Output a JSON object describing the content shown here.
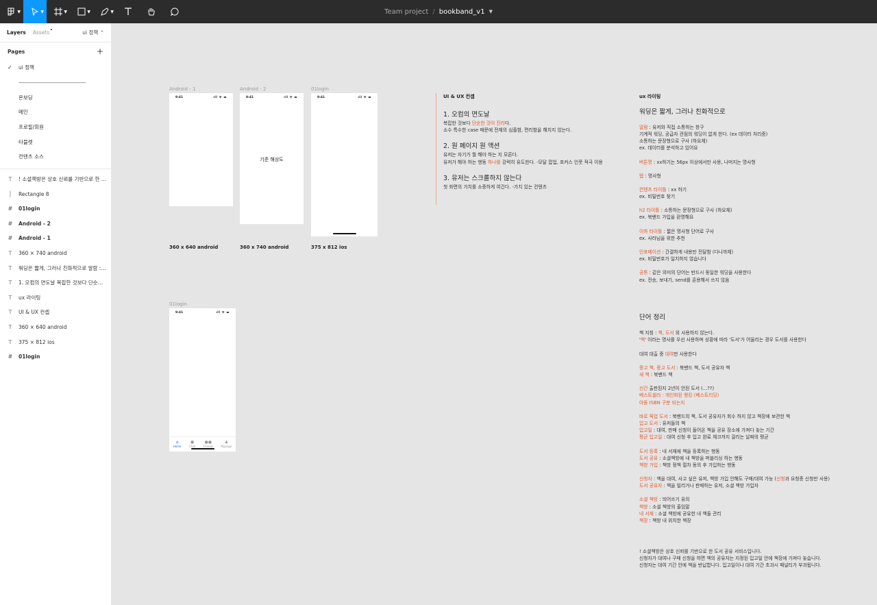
{
  "topbar": {
    "project": "Team project",
    "slash": "/",
    "file": "bookband_v1",
    "tools": [
      "main-menu-icon",
      "move-tool-icon",
      "frame-tool-icon",
      "shape-tool-icon",
      "pen-tool-icon",
      "text-tool-icon",
      "hand-tool-icon",
      "comment-tool-icon"
    ]
  },
  "sidebar": {
    "tab_layers": "Layers",
    "tab_assets": "Assets",
    "page_selector": "ui 정책 ⌃",
    "pages_title": "Pages",
    "pages": [
      {
        "label": "ui 정책",
        "current": true
      },
      {
        "label": "———————————————",
        "current": false
      },
      {
        "label": "온보딩",
        "current": false
      },
      {
        "label": "메인",
        "current": false
      },
      {
        "label": "프로필/회원",
        "current": false
      },
      {
        "label": "타블렛",
        "current": false
      },
      {
        "label": "컨텐츠 소스",
        "current": false
      }
    ],
    "layers": [
      {
        "type": "text",
        "label": "! 소셜책방은 상호 신뢰를 기반으로 한 도..."
      },
      {
        "type": "rect",
        "label": "Rectangle 8"
      },
      {
        "type": "frame",
        "label": "01login"
      },
      {
        "type": "frame",
        "label": "Android - 2"
      },
      {
        "type": "frame",
        "label": "Android - 1"
      },
      {
        "type": "text",
        "label": "360 × 740 android"
      },
      {
        "type": "text",
        "label": "워딩은 짧게, 그러나 친화적으로 알람 : 유..."
      },
      {
        "type": "text",
        "label": "1. 오컴의 면도날 복잡한 것보다 단순한 것..."
      },
      {
        "type": "text",
        "label": "ux 라이팅"
      },
      {
        "type": "text",
        "label": "UI & UX 컨셉"
      },
      {
        "type": "text",
        "label": "360 × 640 android"
      },
      {
        "type": "text",
        "label": "375 × 812 ios"
      },
      {
        "type": "frame",
        "label": "01login"
      }
    ]
  },
  "canvas": {
    "frames": {
      "a1_label": "Android - 1",
      "a2_label": "Android - 2",
      "login_label": "01login",
      "login2_label": "01login",
      "status_time": "9:41",
      "status_icons": "ıll ᯤ ▬",
      "a2_center": "기준 해상도",
      "cap_a1": "360 x 640 android",
      "cap_a2": "360 x 740 android",
      "cap_ios": "375 x 812 ios",
      "tabs": [
        "Home",
        "Chat",
        "Friends",
        "Mypage"
      ]
    },
    "concept": {
      "title": "UI & UX 컨셉",
      "p1_title": "1. 오컴의 면도날",
      "p1_l1_a": "복잡한 것보다 ",
      "p1_l1_o": "단순한 것이 진리",
      "p1_l1_b": "다.",
      "p1_l2": "소수 특수한 case 때문에 전체의 심플함, 편리함을 해치지 않는다.",
      "p2_title": "2. 원 페이지 원 액션",
      "p2_l1": "유저는 자기가 뭘 해야 하는 지 모른다.",
      "p2_l2_a": "유저가 해야 하는 행동 ",
      "p2_l2_o": "하나를",
      "p2_l2_b": " 강력히 유도한다. -모달 팝업, 포커스 인풋 적극 이용",
      "p3_title": "3. 유저는 스크롤하지 않는다",
      "p3_l1": "첫 화면의 가치를 소중하게 여긴다. -가치 있는 컨텐츠"
    },
    "ux": {
      "title": "ux 라이팅",
      "heading": "워딩은 짧게, 그러나 친화적으로",
      "alarm_k": "알람",
      "alarm_v": " : 유저와 직접 소통하는 창구",
      "alarm_l2": "기계적 워딩, 공급자 관점의 워딩이 없게 한다. (ex 데이터 처리중)",
      "alarm_l3": "소통하는 문장형으로 구사 (하요체)",
      "alarm_l4": "ex. 데이터를 분석하고 있어요",
      "button_k": "버튼명",
      "button_v": " : xx하기는 56px 이상에서만 사용, 나머지는 명사형",
      "tab_k": "탭",
      "tab_v": " : 명사형",
      "ct_k": "컨텐츠 타이틀",
      "ct_v": " : xx 하기",
      "ct_ex": "ex. 비밀번호 찾기",
      "h2_k": "h2 타이틀",
      "h2_v": " : 소통하는 문장형으로 구사 (하요체)",
      "h2_ex": "ex. 북밴드 가입을 환영해요",
      "sub_k": "이하 타이틀",
      "sub_v": " : 짧은 명사형 단어로 구사",
      "sub_ex": "ex. 사라님을 위한 추천",
      "info_k": "인포메이션",
      "info_v": " : 간결하게 내용만 전달함 (다나까체)",
      "info_ex": "ex. 비밀번호가 일치하지 않습니다",
      "common_k": "공통",
      "common_v": " : 같은 의미의 단어는 반드시 동일한 워딩을 사용한다",
      "common_ex": "ex. 전송, 보내기, send를 혼용해서 쓰지 않음"
    },
    "words": {
      "title": "단어 정리",
      "w1_a": "책 지칭 : ",
      "w1_o": "책, 도서",
      "w1_b": " 외 사용하지 않는다.",
      "w2_a": "'",
      "w2_o": "책",
      "w2_b": "' 이라는 명사를 우선 사용하며 상황에 따라 '도서'가 어울리는 경우 도서를 사용한다",
      "w3_a": "대여 대출 중 ",
      "w3_o": "대여",
      "w3_b": "만 사용한다",
      "w4_o": "중고 책, 중고 도서",
      "w4_b": " : 북밴드 책, 도서 공유자 책",
      "w5_o": "새 책",
      "w5_b": " : 북밴드 책",
      "w6_o": "신간",
      "w6_b": " 출판된지 2년이 안된 도서 (...??)",
      "w7_o": "베스트셀러 : 개인화된 랭킹 (베스트리딩)",
      "w8_o": "아동 ISBN 구분 되는지",
      "w9_o": "바로 픽업 도서",
      "w9_b": " : 북밴드의 책, 도서 공유자가 회수 하지 않고 책장에 보관한 책",
      "w10_o": "입고 도서",
      "w10_b": " : 유저들의 책",
      "w11_o": "입고일",
      "w11_b": " : 대여, 판매 신청이 들어온 책을 공유 장소에 가져다 놓는 기간",
      "w12_o": "평균 입고일",
      "w12_b": " : 대여 신청 후 입고 완료 체크까지 걸리는 날짜의 평균",
      "w13_o": "도서 등록",
      "w13_b": " : 내 서재에 책을 등록하는 행동",
      "w14_o": "도서 공유",
      "w14_b": " : 소셜책방에 내 책방을 퍼블리싱 하는 행동",
      "w15_o": "책방 가입",
      "w15_b": " : 책방 정책 절차 동의 후 가입하는 행동",
      "w16_o": "신청자",
      "w16_b": " : 책을 대여, 사고 싶은 유저, 책방 가입 안해도 구매/대여 가능 (",
      "w16_o2": "신청",
      "w16_c": "과 요청중 신청만 사용)",
      "w17_o": "도서 공유자",
      "w17_b": " : 책을 빌리거나 판매하는 유저, 소셜 책방 가입자",
      "w18_o": "소셜 책방",
      "w18_b": " : 띄어쓰기 유의",
      "w19_o": "책방",
      "w19_b": " : 소셜 책방의 줄임말",
      "w20_o": "내 서재",
      "w20_b": " : 소셜 책방에 공유한 내 책들 관리",
      "w21_o": "책장",
      "w21_b": " : 책방 내 위치한 책장"
    },
    "note": {
      "l1": "! 소셜책방은 상호 신뢰를 기반으로 한 도서 공유 서비스입니다.",
      "l2": "신청자가 대여나 구매 신청을 하면 책의 공유자는 지정된 입고일 안에 책장에 가져다 놓습니다.",
      "l3": "신청자는 대여 기간 안에 책을 반납합니다. 입고일이나 대여 기간 초과시 패널티가 부과됩니다."
    }
  },
  "colors": {
    "accent": "#e2572a",
    "toolbar": "#2c2c2c",
    "active_tool": "#0d99ff",
    "tab_active": "#1e6cf0"
  }
}
